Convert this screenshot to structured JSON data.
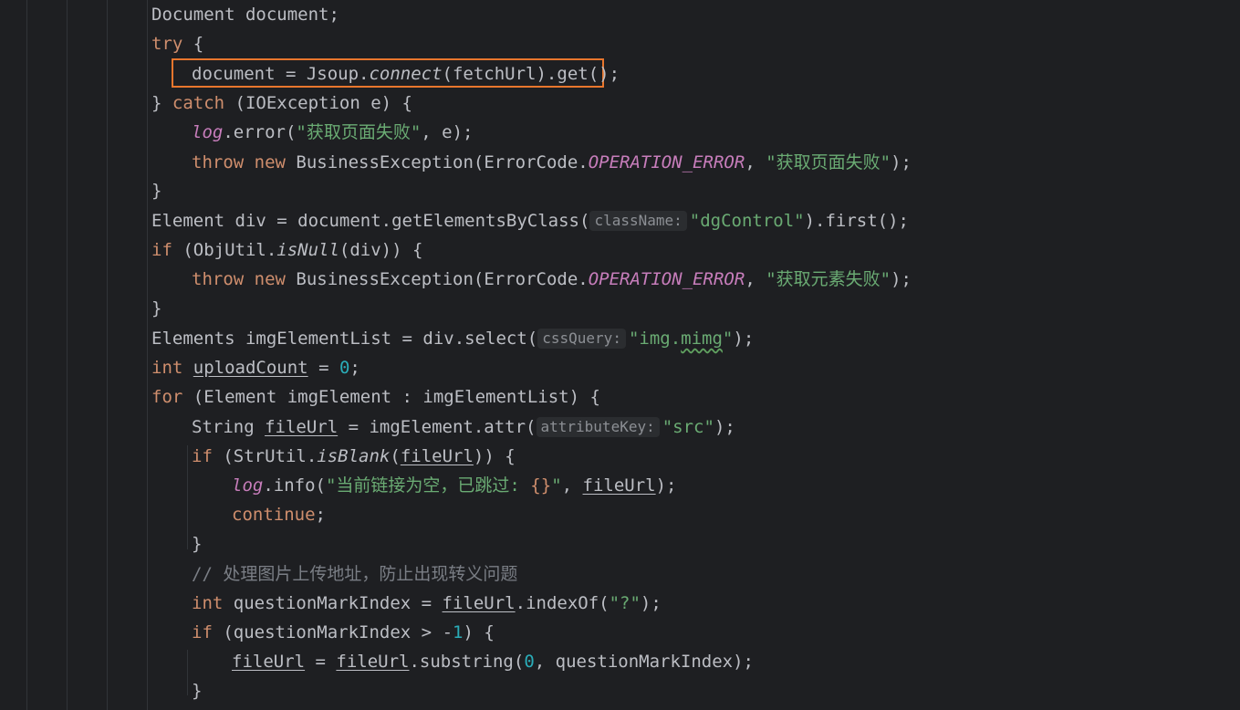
{
  "code": {
    "line1": {
      "type": "Document",
      "var": "document;"
    },
    "line2": {
      "kw": "try",
      "rest": " {"
    },
    "line3": {
      "lhs": "document = Jsoup.",
      "method": "connect",
      "rest": "(fetchUrl).get();"
    },
    "line4": {
      "open": "} ",
      "kw": "catch",
      "rest": " (IOException e) {"
    },
    "line5": {
      "log": "log",
      "call": ".error(",
      "str": "\"获取页面失败\"",
      "rest": ", e);"
    },
    "line6": {
      "kw1": "throw",
      "kw2": "new",
      "mid": " BusinessException(ErrorCode.",
      "const": "OPERATION_ERROR",
      "sep": ", ",
      "str": "\"获取页面失败\"",
      "end": ");"
    },
    "line7": {
      "text": "}"
    },
    "line8": {
      "pre": "Element div = document.getElementsByClass(",
      "hint": "className:",
      "str": "\"dgControl\"",
      "end": ").first();"
    },
    "line9": {
      "kw": "if",
      "pre": " (ObjUtil.",
      "method": "isNull",
      "end": "(div)) {"
    },
    "line10": {
      "kw1": "throw",
      "kw2": "new",
      "mid": " BusinessException(ErrorCode.",
      "const": "OPERATION_ERROR",
      "sep": ", ",
      "str": "\"获取元素失败\"",
      "end": ");"
    },
    "line11": {
      "text": "}"
    },
    "line12": {
      "pre": "Elements imgElementList = div.select(",
      "hint": "cssQuery:",
      "str_a": "\"img.",
      "str_b": "mimg",
      "str_c": "\"",
      "end": ");"
    },
    "line13": {
      "kw": "int",
      "var": "uploadCount",
      "mid": " = ",
      "num": "0",
      "end": ";"
    },
    "line14": {
      "kw": "for",
      "rest": " (Element imgElement : imgElementList) {"
    },
    "line15": {
      "pre": "String ",
      "var": "fileUrl",
      "mid": " = imgElement.attr(",
      "hint": "attributeKey:",
      "str": "\"src\"",
      "end": ");"
    },
    "line16": {
      "kw": "if",
      "pre": " (StrUtil.",
      "method": "isBlank",
      "paren": "(",
      "var": "fileUrl",
      "end": ")) {"
    },
    "line17": {
      "log": "log",
      "call": ".info(",
      "str_a": "\"当前链接为空，已跳过: ",
      "braces": "{}",
      "str_b": "\"",
      "sep": ", ",
      "var": "fileUrl",
      "end": ");"
    },
    "line18": {
      "kw": "continue",
      "end": ";"
    },
    "line19": {
      "text": "}"
    },
    "line20": {
      "comment": "// 处理图片上传地址，防止出现转义问题"
    },
    "line21": {
      "kw": "int",
      "pre": " questionMarkIndex = ",
      "var": "fileUrl",
      "end": ".indexOf(",
      "str": "\"?\"",
      "end2": ");"
    },
    "line22": {
      "kw": "if",
      "pre": " (questionMarkIndex > ",
      "minus": "-",
      "num": "1",
      "end": ") {"
    },
    "line23": {
      "var1": "fileUrl",
      "mid": " = ",
      "var2": "fileUrl",
      "call": ".substring(",
      "num": "0",
      "end": ", questionMarkIndex);"
    },
    "line24": {
      "text": "}"
    }
  },
  "colors": {
    "background": "#1e1f22",
    "keyword": "#cf8e6d",
    "string": "#6aab73",
    "number": "#2aacb8",
    "constant": "#c77dbb",
    "highlight_border": "#e8762d"
  }
}
